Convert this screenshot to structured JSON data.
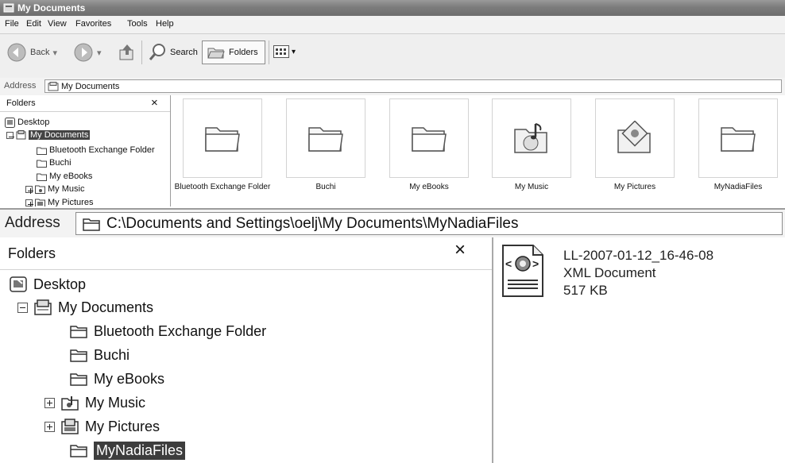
{
  "window_title": "My Documents",
  "menu": [
    "File",
    "Edit",
    "View",
    "Favorites",
    "Tools",
    "Help"
  ],
  "toolbar": {
    "back_label": "Back",
    "search_label": "Search",
    "folders_label": "Folders"
  },
  "small_address": {
    "label": "Address",
    "value": "My Documents"
  },
  "small_pane": {
    "title": "Folders",
    "items": [
      {
        "label": "Desktop"
      },
      {
        "label": "My Documents"
      },
      {
        "label": "Bluetooth Exchange Folder"
      },
      {
        "label": "Buchi"
      },
      {
        "label": "My eBooks"
      },
      {
        "label": "My Music"
      },
      {
        "label": "My Pictures"
      }
    ]
  },
  "tiles": [
    {
      "label": "Bluetooth Exchange Folder",
      "icon": "folder-icon"
    },
    {
      "label": "Buchi",
      "icon": "folder-icon"
    },
    {
      "label": "My eBooks",
      "icon": "folder-icon"
    },
    {
      "label": "My Music",
      "icon": "music-folder-icon"
    },
    {
      "label": "My Pictures",
      "icon": "pictures-folder-icon"
    },
    {
      "label": "MyNadiaFiles",
      "icon": "folder-icon"
    }
  ],
  "big_address": {
    "label": "Address",
    "value": "C:\\Documents and Settings\\oelj\\My Documents\\MyNadiaFiles"
  },
  "big_pane": {
    "title": "Folders",
    "items": [
      {
        "label": "Desktop"
      },
      {
        "label": "My Documents"
      },
      {
        "label": "Bluetooth Exchange Folder"
      },
      {
        "label": "Buchi"
      },
      {
        "label": "My eBooks"
      },
      {
        "label": "My Music"
      },
      {
        "label": "My Pictures"
      },
      {
        "label": "MyNadiaFiles"
      }
    ]
  },
  "file": {
    "name": "LL-2007-01-12_16-46-08",
    "type": "XML Document",
    "size": "517 KB",
    "icon": "xml-file-icon"
  }
}
